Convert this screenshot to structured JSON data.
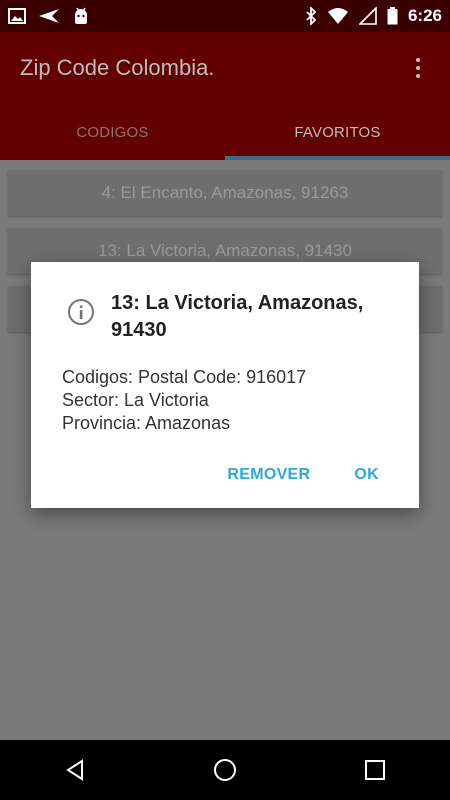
{
  "status_bar": {
    "time": "6:26",
    "icons_left": [
      "image-icon",
      "send-icon",
      "android-icon"
    ],
    "icons_right": [
      "bluetooth-icon",
      "wifi-icon",
      "signal-icon",
      "battery-icon"
    ]
  },
  "app_bar": {
    "title": "Zip Code Colombia."
  },
  "tabs": [
    {
      "label": "CODIGOS",
      "active": false
    },
    {
      "label": "FAVORITOS",
      "active": true
    }
  ],
  "list": {
    "items": [
      "4: El Encanto, Amazonas, 91263",
      "13: La Victoria, Amazonas, 91430",
      ""
    ]
  },
  "dialog": {
    "title": "13: La Victoria, Amazonas, 91430",
    "lines": [
      "Codigos: Postal Code: 916017",
      "Sector: La Victoria",
      "Provincia: Amazonas"
    ],
    "remove_label": "REMOVER",
    "ok_label": "OK"
  },
  "colors": {
    "primary": "#8b0000",
    "accent": "#29a9d6",
    "tab_indicator": "#3d6a86"
  }
}
